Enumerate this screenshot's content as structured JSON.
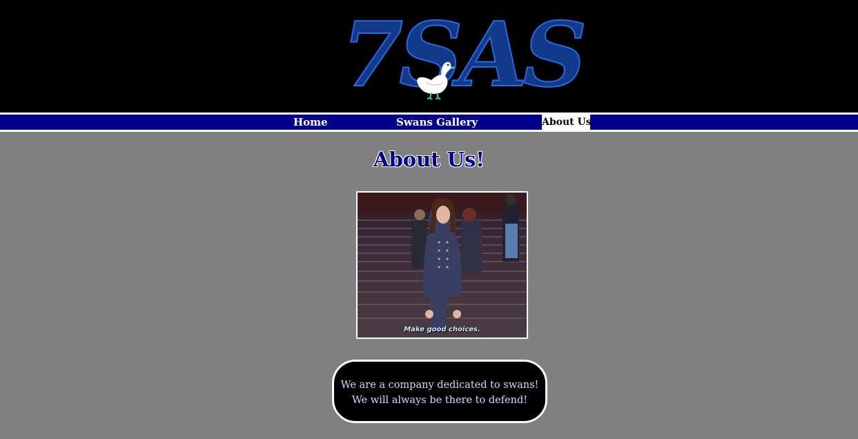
{
  "header": {
    "logo_text": "7SAS",
    "logo_color": "#123a8a",
    "logo_icon": "swan-icon",
    "background": "#000000"
  },
  "nav": {
    "background": "#00008b",
    "items": [
      {
        "label": "Home",
        "active": false
      },
      {
        "label": "Swans Gallery",
        "active": false
      },
      {
        "label": "About Us",
        "active": true
      }
    ]
  },
  "main": {
    "title": "About Us!",
    "photo": {
      "caption": "Make good choices."
    },
    "info_box": {
      "lines": [
        "We are a company dedicated to swans!",
        "We will always be there to defend!"
      ]
    }
  }
}
